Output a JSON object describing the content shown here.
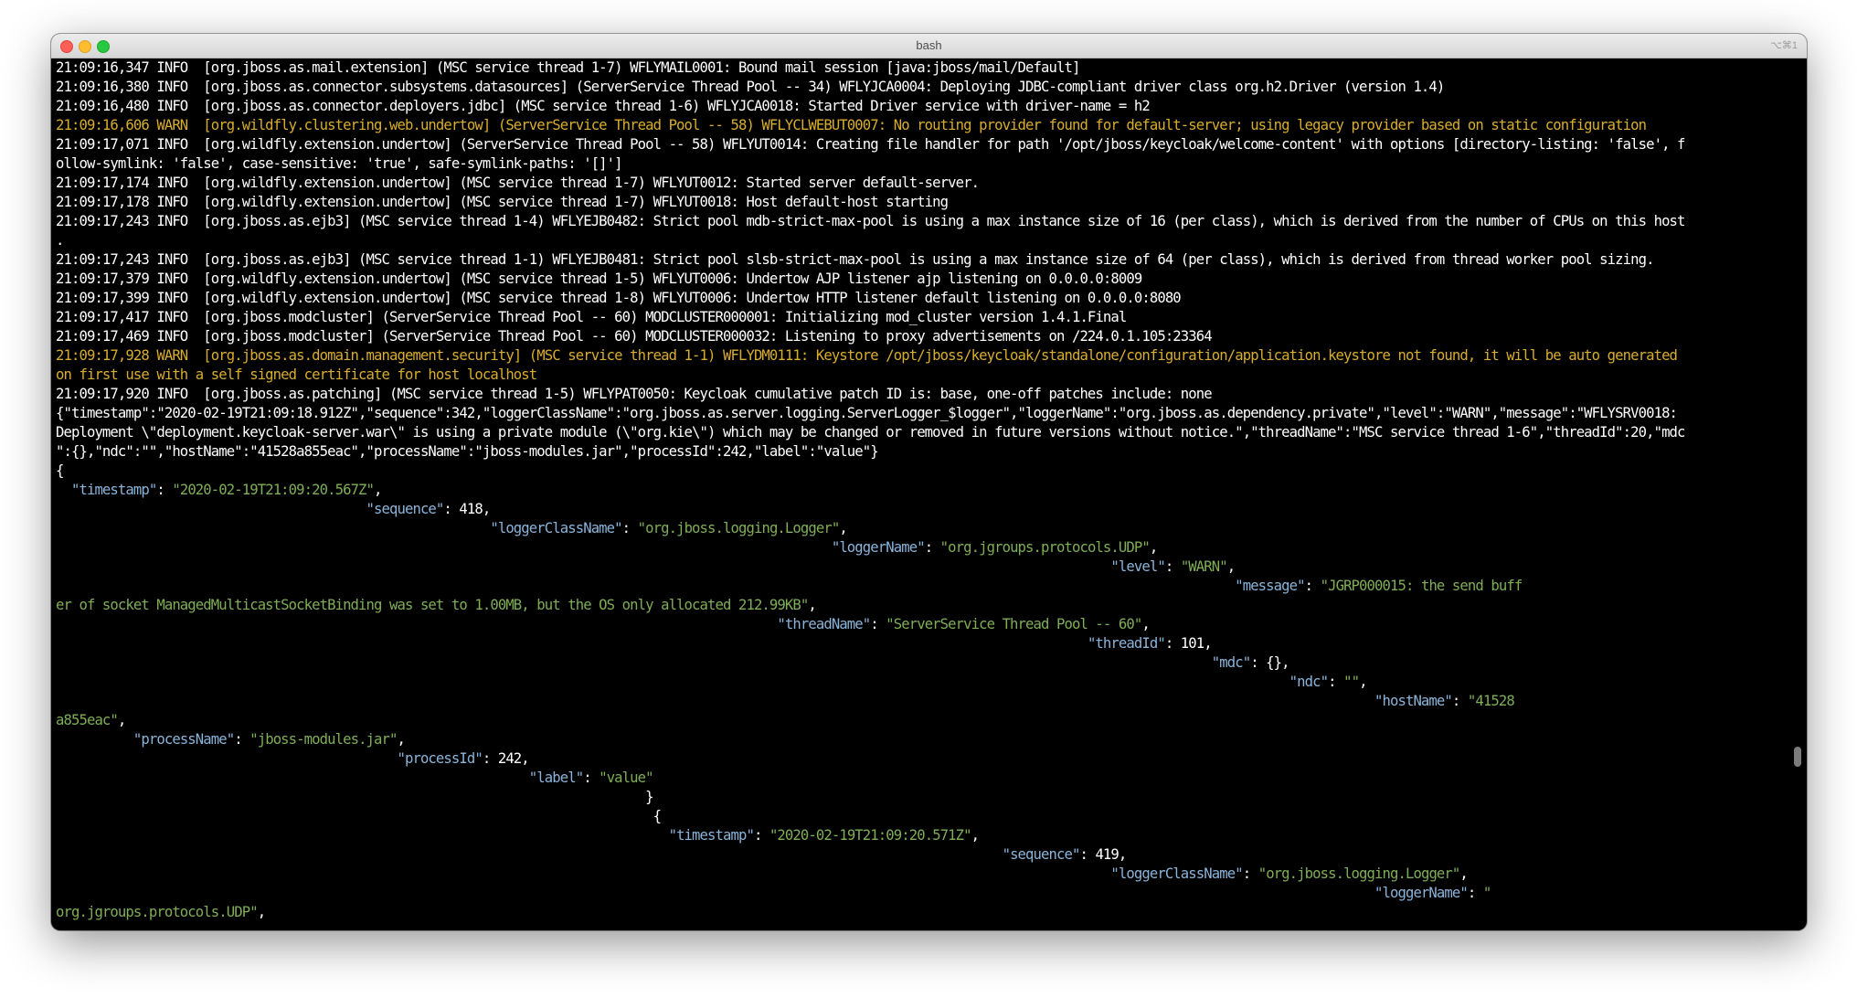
{
  "window": {
    "title": "bash",
    "shortcut": "⌥⌘1"
  },
  "terminal": {
    "lines": [
      {
        "type": "plain",
        "text": "21:09:16,347 INFO  [org.jboss.as.mail.extension] (MSC service thread 1-7) WFLYMAIL0001: Bound mail session [java:jboss/mail/Default]"
      },
      {
        "type": "plain",
        "text": "21:09:16,380 INFO  [org.jboss.as.connector.subsystems.datasources] (ServerService Thread Pool -- 34) WFLYJCA0004: Deploying JDBC-compliant driver class org.h2.Driver (version 1.4)"
      },
      {
        "type": "plain",
        "text": "21:09:16,480 INFO  [org.jboss.as.connector.deployers.jdbc] (MSC service thread 1-6) WFLYJCA0018: Started Driver service with driver-name = h2"
      },
      {
        "type": "warn",
        "text": "21:09:16,606 WARN  [org.wildfly.clustering.web.undertow] (ServerService Thread Pool -- 58) WFLYCLWEBUT0007: No routing provider found for default-server; using legacy provider based on static configuration"
      },
      {
        "type": "plain",
        "text": "21:09:17,071 INFO  [org.wildfly.extension.undertow] (ServerService Thread Pool -- 58) WFLYUT0014: Creating file handler for path '/opt/jboss/keycloak/welcome-content' with options [directory-listing: 'false', f"
      },
      {
        "type": "plain",
        "text": "ollow-symlink: 'false', case-sensitive: 'true', safe-symlink-paths: '[]']"
      },
      {
        "type": "plain",
        "text": "21:09:17,174 INFO  [org.wildfly.extension.undertow] (MSC service thread 1-7) WFLYUT0012: Started server default-server."
      },
      {
        "type": "plain",
        "text": "21:09:17,178 INFO  [org.wildfly.extension.undertow] (MSC service thread 1-7) WFLYUT0018: Host default-host starting"
      },
      {
        "type": "plain",
        "text": "21:09:17,243 INFO  [org.jboss.as.ejb3] (MSC service thread 1-4) WFLYEJB0482: Strict pool mdb-strict-max-pool is using a max instance size of 16 (per class), which is derived from the number of CPUs on this host"
      },
      {
        "type": "plain",
        "text": "."
      },
      {
        "type": "plain",
        "text": "21:09:17,243 INFO  [org.jboss.as.ejb3] (MSC service thread 1-1) WFLYEJB0481: Strict pool slsb-strict-max-pool is using a max instance size of 64 (per class), which is derived from thread worker pool sizing."
      },
      {
        "type": "plain",
        "text": "21:09:17,379 INFO  [org.wildfly.extension.undertow] (MSC service thread 1-5) WFLYUT0006: Undertow AJP listener ajp listening on 0.0.0.0:8009"
      },
      {
        "type": "plain",
        "text": "21:09:17,399 INFO  [org.wildfly.extension.undertow] (MSC service thread 1-8) WFLYUT0006: Undertow HTTP listener default listening on 0.0.0.0:8080"
      },
      {
        "type": "plain",
        "text": "21:09:17,417 INFO  [org.jboss.modcluster] (ServerService Thread Pool -- 60) MODCLUSTER000001: Initializing mod_cluster version 1.4.1.Final"
      },
      {
        "type": "plain",
        "text": "21:09:17,469 INFO  [org.jboss.modcluster] (ServerService Thread Pool -- 60) MODCLUSTER000032: Listening to proxy advertisements on /224.0.1.105:23364"
      },
      {
        "type": "warn",
        "text": "21:09:17,928 WARN  [org.jboss.as.domain.management.security] (MSC service thread 1-1) WFLYDM0111: Keystore /opt/jboss/keycloak/standalone/configuration/application.keystore not found, it will be auto generated"
      },
      {
        "type": "warn",
        "text": "on first use with a self signed certificate for host localhost"
      },
      {
        "type": "plain",
        "text": "21:09:17,920 INFO  [org.jboss.as.patching] (MSC service thread 1-5) WFLYPAT0050: Keycloak cumulative patch ID is: base, one-off patches include: none"
      },
      {
        "type": "plain",
        "text": "{\"timestamp\":\"2020-02-19T21:09:18.912Z\",\"sequence\":342,\"loggerClassName\":\"org.jboss.as.server.logging.ServerLogger_$logger\",\"loggerName\":\"org.jboss.as.dependency.private\",\"level\":\"WARN\",\"message\":\"WFLYSRV0018:"
      },
      {
        "type": "plain",
        "text": "Deployment \\\"deployment.keycloak-server.war\\\" is using a private module (\\\"org.kie\\\") which may be changed or removed in future versions without notice.\",\"threadName\":\"MSC service thread 1-6\",\"threadId\":20,\"mdc"
      },
      {
        "type": "plain",
        "text": "\":{},\"ndc\":\"\",\"hostName\":\"41528a855eac\",\"processName\":\"jboss-modules.jar\",\"processId\":242,\"label\":\"value\"}"
      },
      {
        "type": "plain",
        "text": "{"
      },
      {
        "type": "json",
        "parts": [
          {
            "c": "p",
            "t": "  "
          },
          {
            "c": "k",
            "t": "\"timestamp\""
          },
          {
            "c": "p",
            "t": ": "
          },
          {
            "c": "s",
            "t": "\"2020-02-19T21:09:20.567Z\""
          },
          {
            "c": "p",
            "t": ","
          }
        ]
      },
      {
        "type": "json",
        "parts": [
          {
            "c": "p",
            "t": "                                        "
          },
          {
            "c": "k",
            "t": "\"sequence\""
          },
          {
            "c": "p",
            "t": ": 418,"
          }
        ]
      },
      {
        "type": "json",
        "parts": [
          {
            "c": "p",
            "t": "                                                        "
          },
          {
            "c": "k",
            "t": "\"loggerClassName\""
          },
          {
            "c": "p",
            "t": ": "
          },
          {
            "c": "s",
            "t": "\"org.jboss.logging.Logger\""
          },
          {
            "c": "p",
            "t": ","
          }
        ]
      },
      {
        "type": "json",
        "parts": [
          {
            "c": "p",
            "t": "                                                                                                    "
          },
          {
            "c": "k",
            "t": "\"loggerName\""
          },
          {
            "c": "p",
            "t": ": "
          },
          {
            "c": "s",
            "t": "\"org.jgroups.protocols.UDP\""
          },
          {
            "c": "p",
            "t": ","
          }
        ]
      },
      {
        "type": "json",
        "parts": [
          {
            "c": "p",
            "t": "                                                                                                                                        "
          },
          {
            "c": "k",
            "t": "\"level\""
          },
          {
            "c": "p",
            "t": ": "
          },
          {
            "c": "s",
            "t": "\"WARN\""
          },
          {
            "c": "p",
            "t": ","
          }
        ]
      },
      {
        "type": "json",
        "parts": [
          {
            "c": "p",
            "t": "                                                                                                                                                        "
          },
          {
            "c": "k",
            "t": "\"message\""
          },
          {
            "c": "p",
            "t": ": "
          },
          {
            "c": "s",
            "t": "\"JGRP000015: the send buff"
          }
        ]
      },
      {
        "type": "json",
        "parts": [
          {
            "c": "s",
            "t": "er of socket ManagedMulticastSocketBinding was set to 1.00MB, but the OS only allocated 212.99KB\""
          },
          {
            "c": "p",
            "t": ","
          }
        ]
      },
      {
        "type": "json",
        "parts": [
          {
            "c": "p",
            "t": "                                                                                             "
          },
          {
            "c": "k",
            "t": "\"threadName\""
          },
          {
            "c": "p",
            "t": ": "
          },
          {
            "c": "s",
            "t": "\"ServerService Thread Pool -- 60\""
          },
          {
            "c": "p",
            "t": ","
          }
        ]
      },
      {
        "type": "json",
        "parts": [
          {
            "c": "p",
            "t": "                                                                                                                                     "
          },
          {
            "c": "k",
            "t": "\"threadId\""
          },
          {
            "c": "p",
            "t": ": 101,"
          }
        ]
      },
      {
        "type": "json",
        "parts": [
          {
            "c": "p",
            "t": "                                                                                                                                                     "
          },
          {
            "c": "k",
            "t": "\"mdc\""
          },
          {
            "c": "p",
            "t": ": {},"
          }
        ]
      },
      {
        "type": "json",
        "parts": [
          {
            "c": "p",
            "t": "                                                                                                                                                               "
          },
          {
            "c": "k",
            "t": "\"ndc\""
          },
          {
            "c": "p",
            "t": ": "
          },
          {
            "c": "s",
            "t": "\"\""
          },
          {
            "c": "p",
            "t": ","
          }
        ]
      },
      {
        "type": "json",
        "parts": [
          {
            "c": "p",
            "t": "                                                                                                                                                                          "
          },
          {
            "c": "k",
            "t": "\"hostName\""
          },
          {
            "c": "p",
            "t": ": "
          },
          {
            "c": "s",
            "t": "\"41528"
          }
        ]
      },
      {
        "type": "json",
        "parts": [
          {
            "c": "s",
            "t": "a855eac\""
          },
          {
            "c": "p",
            "t": ","
          }
        ]
      },
      {
        "type": "json",
        "parts": [
          {
            "c": "p",
            "t": "          "
          },
          {
            "c": "k",
            "t": "\"processName\""
          },
          {
            "c": "p",
            "t": ": "
          },
          {
            "c": "s",
            "t": "\"jboss-modules.jar\""
          },
          {
            "c": "p",
            "t": ","
          }
        ]
      },
      {
        "type": "json",
        "parts": [
          {
            "c": "p",
            "t": "                                            "
          },
          {
            "c": "k",
            "t": "\"processId\""
          },
          {
            "c": "p",
            "t": ": 242,"
          }
        ]
      },
      {
        "type": "json",
        "parts": [
          {
            "c": "p",
            "t": "                                                             "
          },
          {
            "c": "k",
            "t": "\"label\""
          },
          {
            "c": "p",
            "t": ": "
          },
          {
            "c": "s",
            "t": "\"value\""
          }
        ]
      },
      {
        "type": "json",
        "parts": [
          {
            "c": "p",
            "t": "                                                                            }"
          }
        ]
      },
      {
        "type": "json",
        "parts": [
          {
            "c": "p",
            "t": "                                                                             {"
          }
        ]
      },
      {
        "type": "json",
        "parts": [
          {
            "c": "p",
            "t": "                                                                               "
          },
          {
            "c": "k",
            "t": "\"timestamp\""
          },
          {
            "c": "p",
            "t": ": "
          },
          {
            "c": "s",
            "t": "\"2020-02-19T21:09:20.571Z\""
          },
          {
            "c": "p",
            "t": ","
          }
        ]
      },
      {
        "type": "json",
        "parts": [
          {
            "c": "p",
            "t": "                                                                                                                          "
          },
          {
            "c": "k",
            "t": "\"sequence\""
          },
          {
            "c": "p",
            "t": ": 419,"
          }
        ]
      },
      {
        "type": "json",
        "parts": [
          {
            "c": "p",
            "t": "                                                                                                                                        "
          },
          {
            "c": "k",
            "t": "\"loggerClassName\""
          },
          {
            "c": "p",
            "t": ": "
          },
          {
            "c": "s",
            "t": "\"org.jboss.logging.Logger\""
          },
          {
            "c": "p",
            "t": ","
          }
        ]
      },
      {
        "type": "json",
        "parts": [
          {
            "c": "p",
            "t": "                                                                                                                                                                          "
          },
          {
            "c": "k",
            "t": "\"loggerName\""
          },
          {
            "c": "p",
            "t": ": "
          },
          {
            "c": "s",
            "t": "\""
          }
        ]
      },
      {
        "type": "json",
        "parts": [
          {
            "c": "s",
            "t": "org.jgroups.protocols.UDP\""
          },
          {
            "c": "p",
            "t": ","
          }
        ]
      }
    ]
  },
  "colors": {
    "terminal_bg": "#000000",
    "text": "#ffffff",
    "warn": "#d8ad2e",
    "json_key": "#8ab4da",
    "json_string": "#7fae57"
  },
  "icons": {
    "close": "close-icon",
    "minimize": "minimize-icon",
    "zoom": "zoom-icon"
  }
}
